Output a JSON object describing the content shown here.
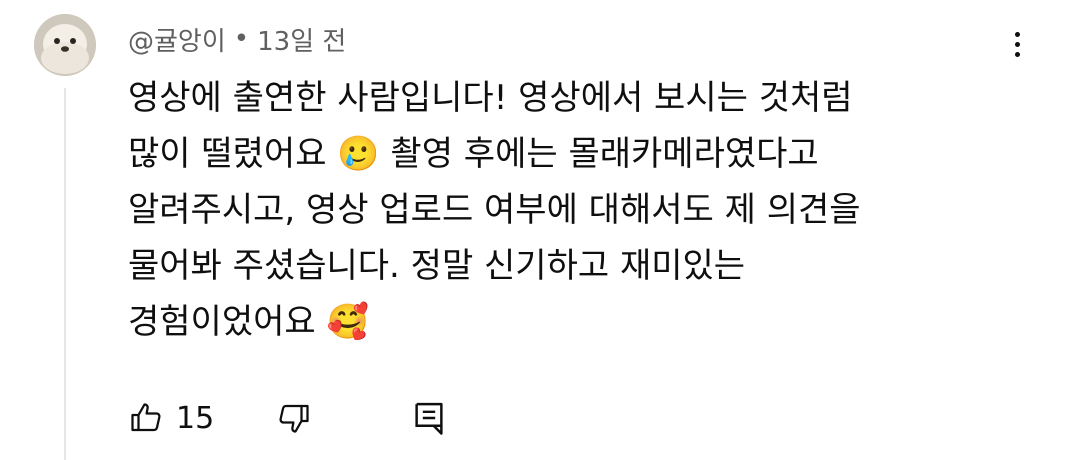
{
  "comment": {
    "author": "@귤앙이",
    "separator": "•",
    "time": "13일 전",
    "lines": [
      "영상에 출연한 사람입니다! 영상에서 보시는 것처럼",
      "많이 떨렸어요 🥲 촬영 후에는 몰래카메라였다고",
      "알려주시고, 영상 업로드 여부에 대해서도 제 의견을",
      "물어봐 주셨습니다. 정말 신기하고 재미있는",
      "경험이었어요 🥰"
    ],
    "likes": "15"
  },
  "icons": {
    "avatar": "seal-avatar",
    "more": "more-vertical-icon",
    "like": "thumbs-up-icon",
    "dislike": "thumbs-down-icon",
    "reply": "reply-comment-icon"
  }
}
